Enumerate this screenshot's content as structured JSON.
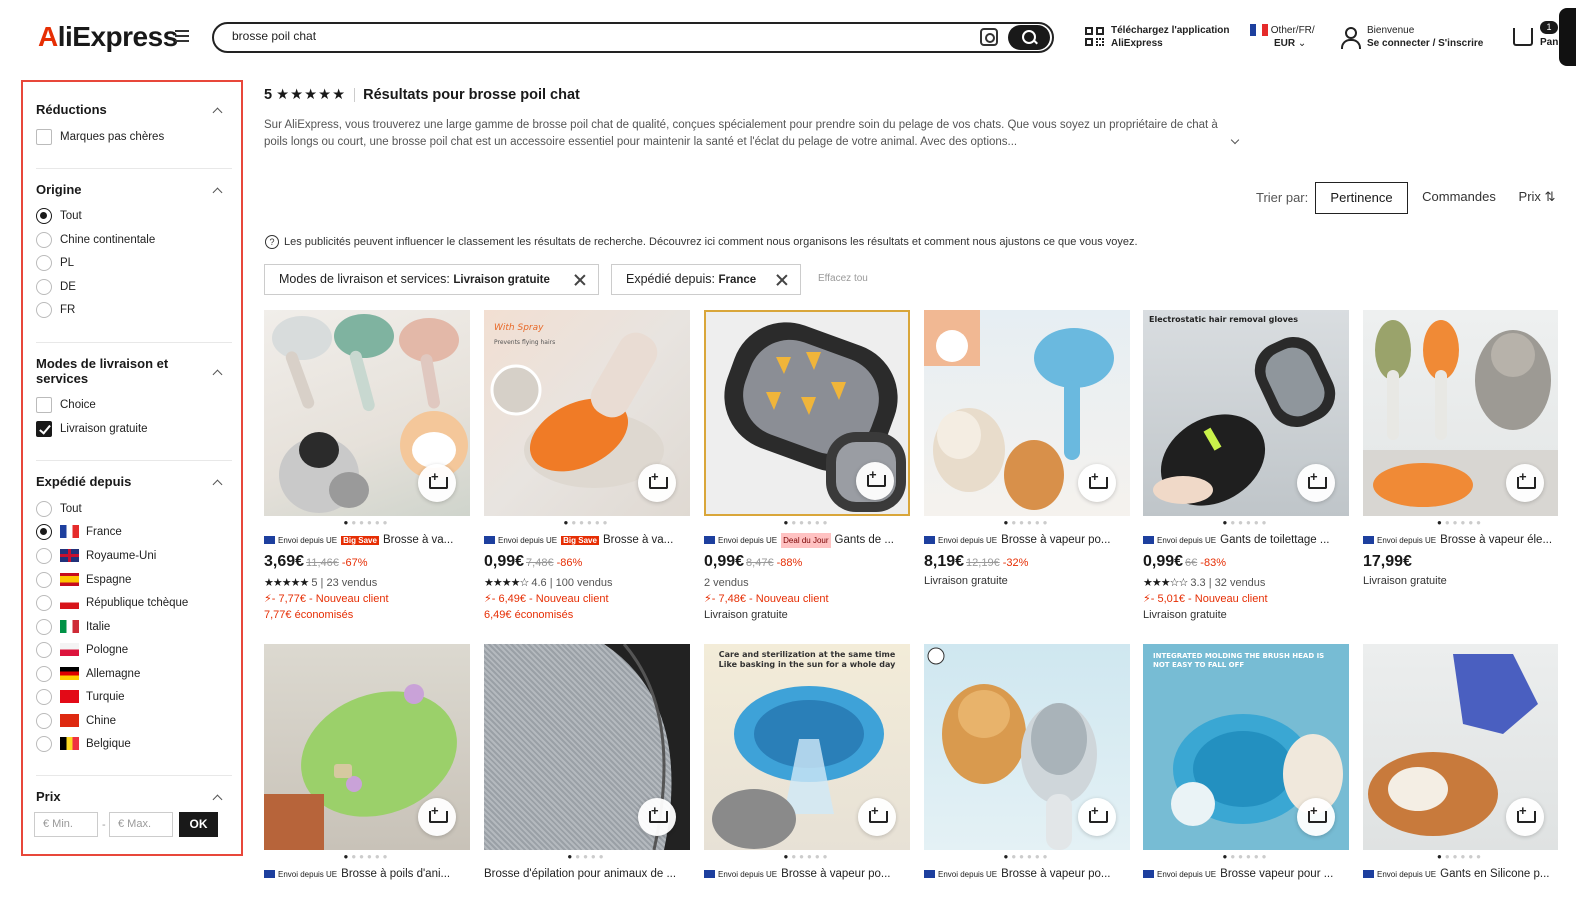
{
  "header": {
    "logo": "AliExpress",
    "search_value": "brosse poil chat",
    "app_line1": "Téléchargez l'application",
    "app_line2": "AliExpress",
    "locale_line1": "Other/FR/",
    "locale_line2": "EUR",
    "welcome": "Bienvenue",
    "signin": "Se connecter / S'inscrire",
    "cart_count": "1",
    "cart_label": "Pan"
  },
  "sidebar": {
    "reductions": {
      "title": "Réductions",
      "items": [
        {
          "label": "Marques pas chères",
          "checked": false
        }
      ]
    },
    "origin": {
      "title": "Origine",
      "items": [
        {
          "label": "Tout",
          "selected": true
        },
        {
          "label": "Chine continentale",
          "selected": false
        },
        {
          "label": "PL",
          "selected": false
        },
        {
          "label": "DE",
          "selected": false
        },
        {
          "label": "FR",
          "selected": false
        }
      ]
    },
    "delivery": {
      "title_l1": "Modes de livraison et",
      "title_l2": "services",
      "items": [
        {
          "label": "Choice",
          "checked": false
        },
        {
          "label": "Livraison gratuite",
          "checked": true
        }
      ]
    },
    "shipped_from": {
      "title": "Expédié depuis",
      "items": [
        {
          "label": "Tout",
          "selected": false
        },
        {
          "label": "France",
          "selected": true
        },
        {
          "label": "Royaume-Uni",
          "selected": false
        },
        {
          "label": "Espagne",
          "selected": false
        },
        {
          "label": "République tchèque",
          "selected": false
        },
        {
          "label": "Italie",
          "selected": false
        },
        {
          "label": "Pologne",
          "selected": false
        },
        {
          "label": "Allemagne",
          "selected": false
        },
        {
          "label": "Turquie",
          "selected": false
        },
        {
          "label": "Chine",
          "selected": false
        },
        {
          "label": "Belgique",
          "selected": false
        }
      ]
    },
    "price": {
      "title": "Prix",
      "min_placeholder": "€ Min.",
      "max_placeholder": "€ Max.",
      "ok": "OK"
    }
  },
  "results": {
    "rating_prefix": "5",
    "stars": "★★★★★",
    "title": "Résultats pour brosse poil chat",
    "description": "Sur AliExpress, vous trouverez une large gamme de brosse poil chat de qualité, conçues spécialement pour prendre soin du pelage de vos chats. Que vous soyez un propriétaire de chat à poils longs ou court, une brosse poil chat est un accessoire essentiel pour maintenir la santé et l'éclat du pelage de votre animal. Avec des options...",
    "sort_label": "Trier par:",
    "sort_options": [
      "Pertinence",
      "Commandes",
      "Prix"
    ],
    "notice": "Les publicités peuvent influencer le classement les résultats de recherche. Découvrez ici comment nous organisons les résultats et comment nous ajustons ce que vous voyez.",
    "chip1_label": "Modes de livraison et services:",
    "chip1_value": "Livraison gratuite",
    "chip2_label": "Expédié depuis:",
    "chip2_value": "France",
    "clear_all": "Effacez tou"
  },
  "products": [
    {
      "eu": "Envoi depuis UE",
      "tag": "Big Save",
      "title": "Brosse à va...",
      "price": "3,69€",
      "old": "11,46€",
      "disc": "-67%",
      "rating": "★★★★★",
      "rating_num": "5",
      "sold": "23 vendus",
      "coupon": "- 7,77€ - Nouveau client",
      "extra": "7,77€ économisés"
    },
    {
      "eu": "Envoi depuis UE",
      "tag": "Big Save",
      "title": "Brosse à va...",
      "price": "0,99€",
      "old": "7,48€",
      "disc": "-86%",
      "rating": "★★★★☆",
      "rating_num": "4.6",
      "sold": "100 vendus",
      "coupon": "- 6,49€ - Nouveau client",
      "extra": "6,49€ économisés"
    },
    {
      "eu": "Envoi depuis UE",
      "tag": "Deal du Jour",
      "title": "Gants de ...",
      "price": "0,99€",
      "old": "8,47€",
      "disc": "-88%",
      "rating": "",
      "rating_num": "",
      "sold": "2 vendus",
      "coupon": "- 7,48€ - Nouveau client",
      "extra": "Livraison gratuite"
    },
    {
      "eu": "Envoi depuis UE",
      "tag": "",
      "title": "Brosse à vapeur po...",
      "price": "8,19€",
      "old": "12,19€",
      "disc": "-32%",
      "rating": "",
      "rating_num": "",
      "sold": "Livraison gratuite",
      "coupon": "",
      "extra": ""
    },
    {
      "eu": "Envoi depuis UE",
      "tag": "",
      "title": "Gants de toilettage ...",
      "price": "0,99€",
      "old": "6€",
      "disc": "-83%",
      "rating": "★★★☆☆",
      "rating_num": "3.3",
      "sold": "32 vendus",
      "coupon": "- 5,01€ - Nouveau client",
      "extra": "Livraison gratuite"
    },
    {
      "eu": "Envoi depuis UE",
      "tag": "",
      "title": "Brosse à vapeur éle...",
      "price": "17,99€",
      "old": "",
      "disc": "",
      "rating": "",
      "rating_num": "",
      "sold": "Livraison gratuite",
      "coupon": "",
      "extra": ""
    },
    {
      "eu": "Envoi depuis UE",
      "title": "Brosse à poils d'ani..."
    },
    {
      "eu": "",
      "title": "Brosse d'épilation pour animaux de ..."
    },
    {
      "eu": "Envoi depuis UE",
      "title": "Brosse à vapeur po..."
    },
    {
      "eu": "Envoi depuis UE",
      "title": "Brosse à vapeur po..."
    },
    {
      "eu": "Envoi depuis UE",
      "title": "Brosse vapeur pour ..."
    },
    {
      "eu": "Envoi depuis UE",
      "title": "Gants en Silicone p..."
    }
  ],
  "image_overlays": {
    "p2": "With Spray",
    "p2b": "Prevents flying hairs",
    "p5": "Electrostatic hair removal gloves",
    "p9": "Care and sterilization at the same time Like basking in the sun for a whole day",
    "p11": "INTEGRATED MOLDING THE BRUSH HEAD IS NOT EASY TO FALL OFF"
  }
}
